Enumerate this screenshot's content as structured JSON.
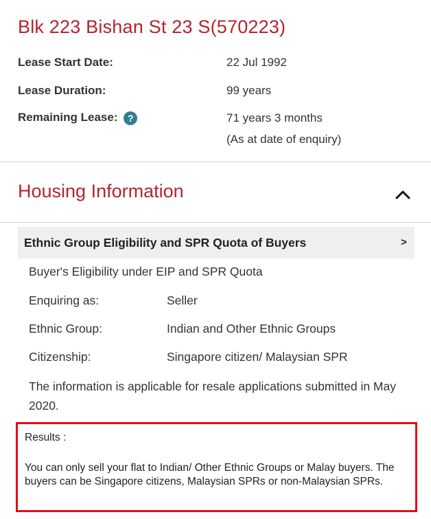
{
  "address": "Blk 223 Bishan St 23 S(570223)",
  "lease": {
    "start_label": "Lease Start Date:",
    "start_value": "22 Jul 1992",
    "duration_label": "Lease Duration:",
    "duration_value": "99 years",
    "remaining_label": "Remaining Lease:",
    "remaining_value": "71 years 3 months",
    "remaining_note": "(As at date of enquiry)",
    "help_icon": "?"
  },
  "housing_section": {
    "title": "Housing Information",
    "toggle_icon": "chevron-up-icon"
  },
  "accordion": {
    "title": "Ethnic Group Eligibility and SPR Quota of Buyers",
    "arrow": ">"
  },
  "eligibility": {
    "heading": "Buyer's Eligibility under EIP and SPR Quota",
    "rows": [
      {
        "label": "Enquiring as:",
        "value": "Seller"
      },
      {
        "label": "Ethnic Group:",
        "value": "Indian and Other Ethnic Groups"
      },
      {
        "label": "Citizenship:",
        "value": "Singapore citizen/ Malaysian SPR"
      }
    ],
    "note": "The information is applicable for resale applications submitted in May 2020."
  },
  "results": {
    "label": "Results :",
    "text": "You can only sell your flat to Indian/ Other Ethnic Groups or Malay buyers. The buyers can be Singapore citizens, Malaysian SPRs or non-Malaysian SPRs."
  },
  "colors": {
    "brand_red": "#b5242c",
    "help_teal": "#2f7f8c",
    "highlight_red": "#e30c18"
  }
}
